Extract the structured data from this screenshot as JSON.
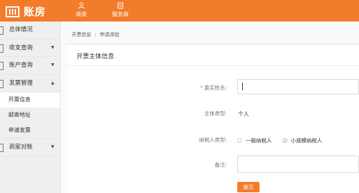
{
  "brand": {
    "name": "账房",
    "accent": "#f27b2c"
  },
  "topnav": [
    {
      "label": "商家",
      "icon": "user-icon"
    },
    {
      "label": "服务商",
      "icon": "document-icon"
    }
  ],
  "sidebar": {
    "items": [
      {
        "label": "总体情况",
        "arrow": ""
      },
      {
        "label": "收支查询",
        "arrow": "▼"
      },
      {
        "label": "账户查询",
        "arrow": "▼"
      },
      {
        "label": "发票管理",
        "arrow": "▲"
      }
    ],
    "subitems": [
      {
        "label": "开票信息",
        "active": true
      },
      {
        "label": "邮寄地址",
        "active": false
      },
      {
        "label": "申请发票",
        "active": false
      }
    ],
    "last_item": {
      "label": "商家对账",
      "arrow": "▼"
    }
  },
  "breadcrumb": {
    "first": "开票信息",
    "second": "申请添加",
    "separator": "/"
  },
  "form": {
    "title": "开票主体信息",
    "required_mark": "*",
    "real_name_label": "真实姓名:",
    "subject_type_label": "主体类型:",
    "subject_type_value": "个人",
    "taxpayer_type_label": "纳税人类型:",
    "taxpayer_options": [
      {
        "label": "一般纳税人",
        "checked": false
      },
      {
        "label": "小规模纳税人",
        "checked": true
      }
    ],
    "remark_label": "备注:",
    "submit_label": "提交"
  }
}
